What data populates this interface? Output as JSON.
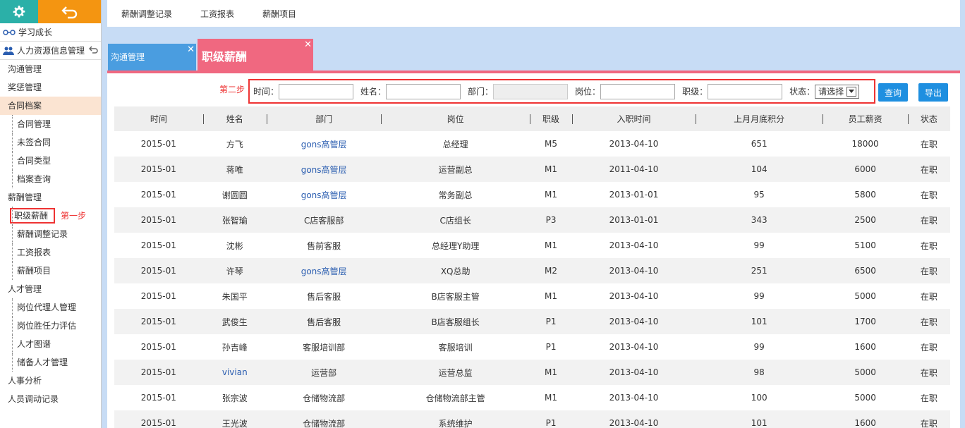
{
  "sidebar": {
    "head1": "学习成长",
    "head2": "人力资源信息管理",
    "items": [
      {
        "label": "沟通管理",
        "type": "item"
      },
      {
        "label": "奖惩管理",
        "type": "item"
      },
      {
        "label": "合同档案",
        "type": "item",
        "active": true
      },
      {
        "label": "合同管理",
        "type": "sub"
      },
      {
        "label": "未签合同",
        "type": "sub"
      },
      {
        "label": "合同类型",
        "type": "sub"
      },
      {
        "label": "档案查询",
        "type": "sub"
      },
      {
        "label": "薪酬管理",
        "type": "item"
      },
      {
        "label": "职级薪酬",
        "type": "sub",
        "boxed": true
      },
      {
        "label": "薪酬调整记录",
        "type": "sub"
      },
      {
        "label": "工资报表",
        "type": "sub"
      },
      {
        "label": "薪酬项目",
        "type": "sub"
      },
      {
        "label": "人才管理",
        "type": "item"
      },
      {
        "label": "岗位代理人管理",
        "type": "sub"
      },
      {
        "label": "岗位胜任力评估",
        "type": "sub"
      },
      {
        "label": "人才图谱",
        "type": "sub"
      },
      {
        "label": "储备人才管理",
        "type": "sub"
      },
      {
        "label": "人事分析",
        "type": "item"
      },
      {
        "label": "人员调动记录",
        "type": "item"
      }
    ],
    "step1": "第一步"
  },
  "topbar": [
    "薪酬调整记录",
    "工资报表",
    "薪酬项目"
  ],
  "tabs": {
    "tab1": "沟通管理",
    "tab2": "职级薪酬",
    "close": "✕"
  },
  "search": {
    "step2": "第二步",
    "time_label": "时间：",
    "name_label": "姓名：",
    "dept_label": "部门：",
    "post_label": "岗位：",
    "rank_label": "职级：",
    "status_label": "状态：",
    "status_value": "请选择",
    "query_btn": "查询",
    "export_btn": "导出"
  },
  "table": {
    "headers": [
      "时间",
      "姓名",
      "部门",
      "岗位",
      "职级",
      "入职时间",
      "上月月底积分",
      "员工薪资",
      "状态"
    ],
    "rows": [
      [
        "2015-01",
        "方飞",
        "gons高管层",
        "总经理",
        "M5",
        "2013-04-10",
        "651",
        "18000",
        "在职"
      ],
      [
        "2015-01",
        "蒋唯",
        "gons高管层",
        "运营副总",
        "M1",
        "2011-04-10",
        "104",
        "6000",
        "在职"
      ],
      [
        "2015-01",
        "谢圆圆",
        "gons高管层",
        "常务副总",
        "M1",
        "2013-01-01",
        "95",
        "5800",
        "在职"
      ],
      [
        "2015-01",
        "张智瑜",
        "C店客服部",
        "C店组长",
        "P3",
        "2013-01-01",
        "343",
        "2500",
        "在职"
      ],
      [
        "2015-01",
        "沈彬",
        "售前客服",
        "总经理Y助理",
        "M1",
        "2013-04-10",
        "99",
        "5100",
        "在职"
      ],
      [
        "2015-01",
        "许琴",
        "gons高管层",
        "XQ总助",
        "M2",
        "2013-04-10",
        "251",
        "6500",
        "在职"
      ],
      [
        "2015-01",
        "朱国平",
        "售后客服",
        "B店客服主管",
        "M1",
        "2013-04-10",
        "99",
        "5000",
        "在职"
      ],
      [
        "2015-01",
        "武俊生",
        "售后客服",
        "B店客服组长",
        "P1",
        "2013-04-10",
        "101",
        "1700",
        "在职"
      ],
      [
        "2015-01",
        "孙吉峰",
        "客服培训部",
        "客服培训",
        "P1",
        "2013-04-10",
        "99",
        "1600",
        "在职"
      ],
      [
        "2015-01",
        "vivian",
        "运营部",
        "运营总监",
        "M1",
        "2013-04-10",
        "98",
        "5000",
        "在职"
      ],
      [
        "2015-01",
        "张宗波",
        "仓储物流部",
        "仓储物流部主管",
        "M1",
        "2013-04-10",
        "100",
        "5000",
        "在职"
      ],
      [
        "2015-01",
        "王光波",
        "仓储物流部",
        "系统维护",
        "P1",
        "2013-04-10",
        "101",
        "1600",
        "在职"
      ]
    ]
  },
  "colors": {
    "teal": "#2bb0a8",
    "orange": "#f49511",
    "pink": "#f06880",
    "blue": "#4a9de0",
    "btn": "#1e8fe0",
    "annot": "#ee3333"
  }
}
